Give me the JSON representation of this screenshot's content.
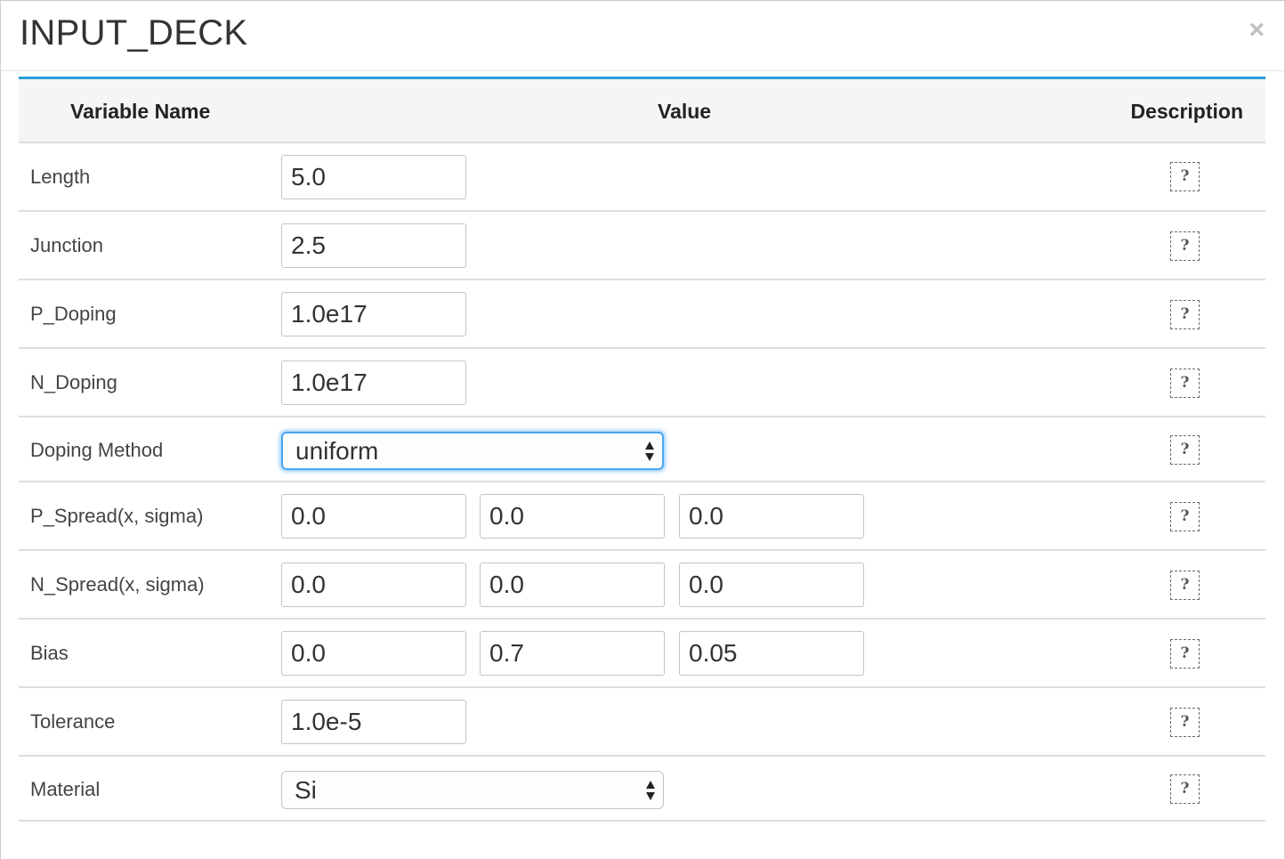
{
  "modal": {
    "title": "INPUT_DECK",
    "close_label": "×"
  },
  "table": {
    "headers": {
      "name": "Variable Name",
      "value": "Value",
      "description": "Description"
    },
    "help_label": "?",
    "rows": [
      {
        "label": "Length",
        "values": [
          "5.0"
        ]
      },
      {
        "label": "Junction",
        "values": [
          "2.5"
        ]
      },
      {
        "label": "P_Doping",
        "values": [
          "1.0e17"
        ]
      },
      {
        "label": "N_Doping",
        "values": [
          "1.0e17"
        ]
      },
      {
        "label": "Doping Method",
        "select": "uniform"
      },
      {
        "label": "P_Spread(x, sigma)",
        "values": [
          "0.0",
          "0.0",
          "0.0"
        ]
      },
      {
        "label": "N_Spread(x, sigma)",
        "values": [
          "0.0",
          "0.0",
          "0.0"
        ]
      },
      {
        "label": "Bias",
        "values": [
          "0.0",
          "0.7",
          "0.05"
        ]
      },
      {
        "label": "Tolerance",
        "values": [
          "1.0e-5"
        ]
      },
      {
        "label": "Material",
        "select": "Si"
      }
    ]
  },
  "colors": {
    "header_accent": "#2a9fd8",
    "focus_ring": "#4da6f0"
  }
}
